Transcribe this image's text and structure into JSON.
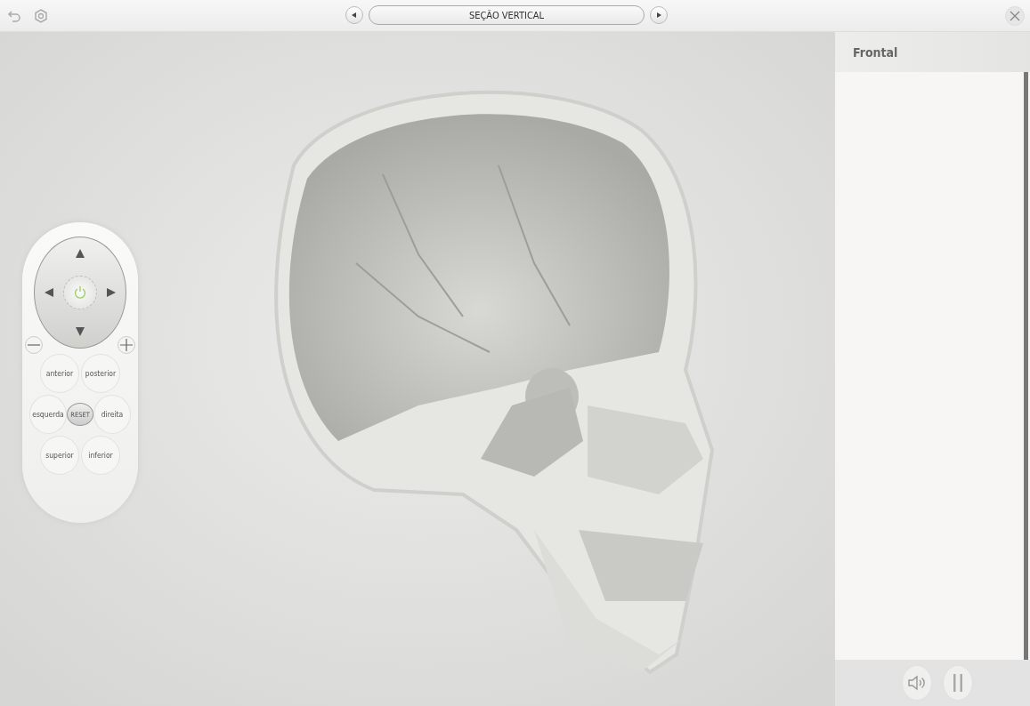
{
  "toolbar": {
    "title": "SEÇÃO VERTICAL"
  },
  "remote": {
    "view_buttons": [
      {
        "label": "anterior",
        "kind": "view"
      },
      {
        "label": "posterior",
        "kind": "view"
      },
      {
        "label": "esquerda",
        "kind": "view"
      },
      {
        "label": "RESET",
        "kind": "reset"
      },
      {
        "label": "direita",
        "kind": "view"
      },
      {
        "label": "superior",
        "kind": "view"
      },
      {
        "label": "inferior",
        "kind": "view"
      }
    ]
  },
  "side_panel": {
    "title": "Frontal"
  }
}
